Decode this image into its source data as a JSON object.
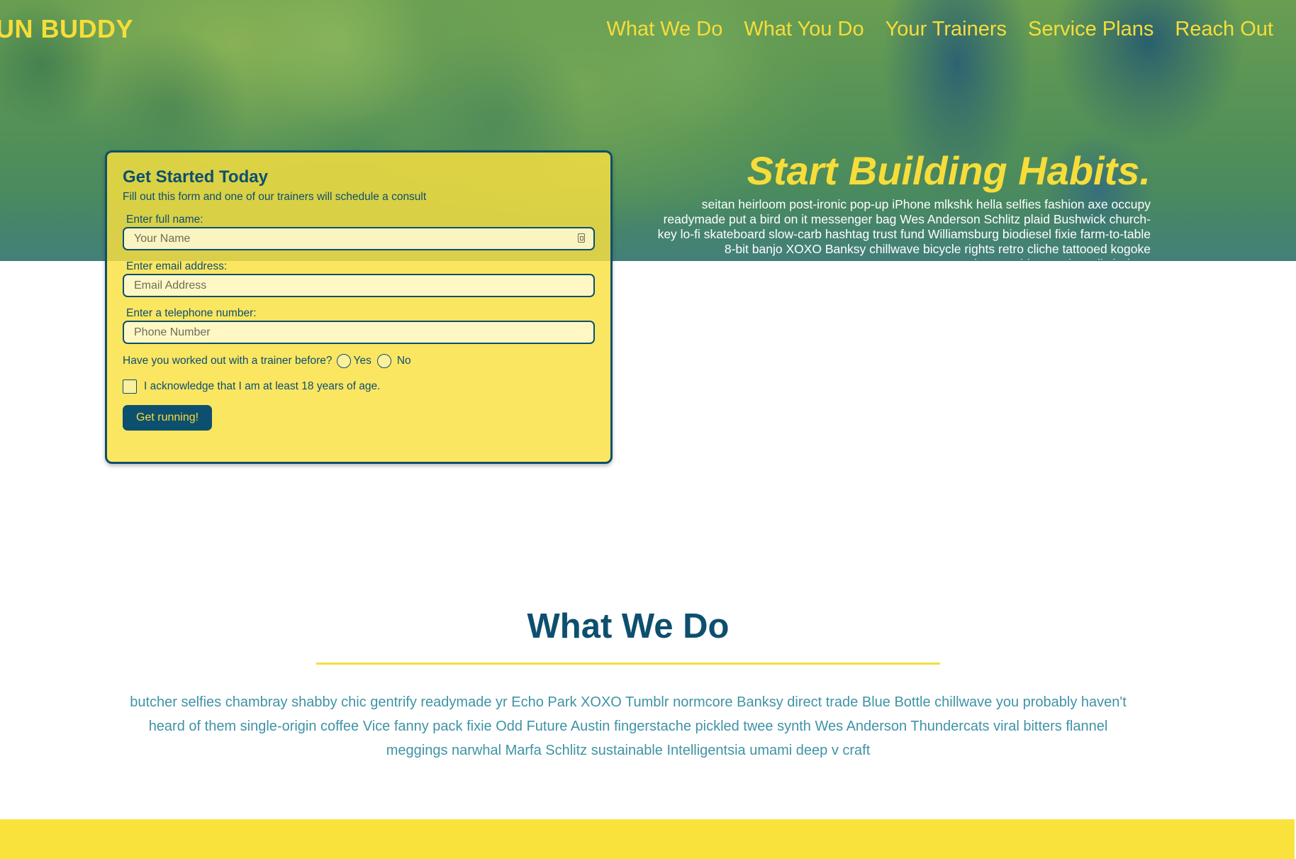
{
  "brand": {
    "logo": "UN BUDDY"
  },
  "nav": {
    "items": [
      "What We Do",
      "What You Do",
      "Your Trainers",
      "Service Plans",
      "Reach Out"
    ]
  },
  "hero": {
    "title": "Start Building Habits.",
    "text": "seitan heirloom post-ironic pop-up iPhone mlkshk hella selfies fashion axe occupy readymade put a bird on it messenger bag Wes Anderson Schlitz plaid Bushwick church-key lo-fi skateboard slow-carb hashtag trust fund Williamsburg biodiesel fixie farm-to-table 8-bit banjo XOXO Banksy chillwave bicycle rights retro cliche tattooed kogoke ingyn...chicago Shoreditch deep"
  },
  "form": {
    "title": "Get Started Today",
    "subtitle": "Fill out this form and one of our trainers will schedule a consult",
    "name_label": "Enter full name:",
    "name_placeholder": "Your Name",
    "email_label": "Enter email address:",
    "email_placeholder": "Email Address",
    "phone_label": "Enter a telephone number:",
    "phone_placeholder": "Phone Number",
    "trainer_question": "Have you worked out with a trainer before?",
    "yes_label": "Yes",
    "no_label": "No",
    "age_ack": "I acknowledge that I am at least 18 years of age.",
    "submit_label": "Get running!"
  },
  "what_we_do": {
    "title": "What We Do",
    "text": "butcher selfies chambray shabby chic gentrify readymade yr Echo Park XOXO Tumblr normcore Banksy direct trade Blue Bottle chillwave you probably haven't heard of them single-origin coffee Vice fanny pack fixie Odd Future Austin fingerstache pickled twee synth Wes Anderson Thundercats viral bitters flannel meggings narwhal Marfa Schlitz sustainable Intelligentsia umami deep v craft"
  },
  "colors": {
    "brand_yellow": "#f7dd3a",
    "brand_navy": "#0d4f6e",
    "body_teal": "#3f93a6"
  }
}
